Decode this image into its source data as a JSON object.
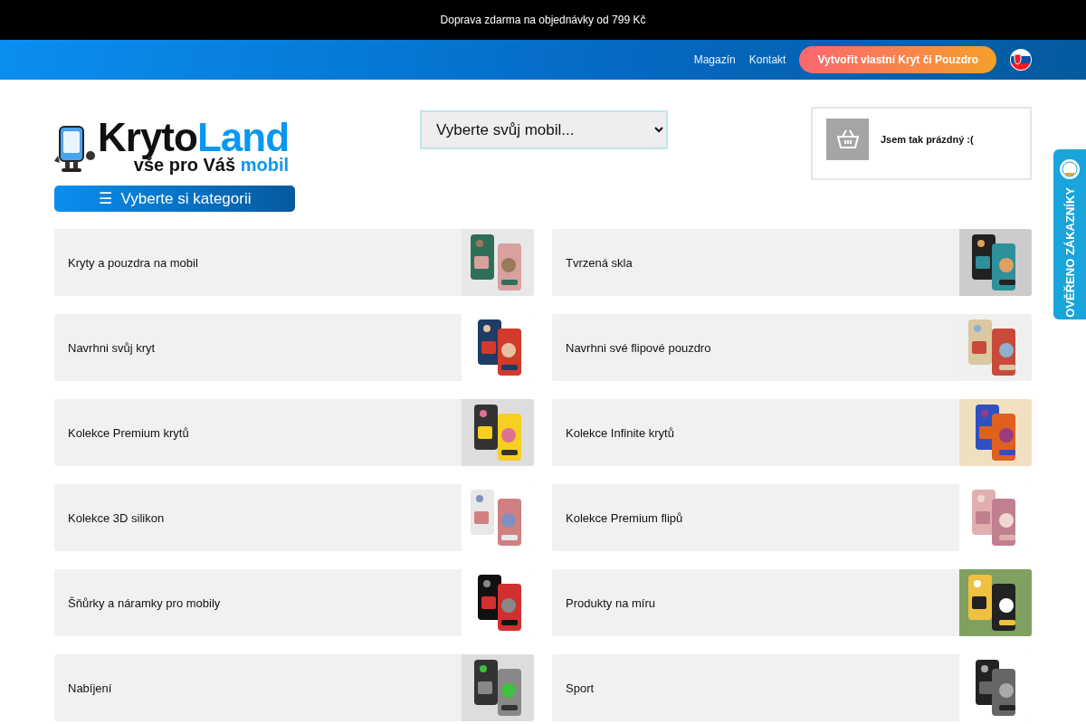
{
  "promo_bar": {
    "text": "Doprava zdarma na objednávky od 799 Kč"
  },
  "nav": {
    "links": [
      "Magazín",
      "Kontakt"
    ],
    "cta": "Vytvořit vlastní Kryt či Pouzdro"
  },
  "logo": {
    "word_1": "Kryto",
    "word_2": "Land",
    "tagline_1": "vše pro Váš",
    "tagline_2": "mobil"
  },
  "category_menu": {
    "icon": "☰",
    "label": "Vyberte si kategorii"
  },
  "phone_select": {
    "value": "Vyberte svůj mobil..."
  },
  "cart": {
    "text": "Jsem tak prázdný :("
  },
  "categories": [
    {
      "label": "Kryty a pouzdra na mobil",
      "kind": "picture"
    },
    {
      "label": "Tvrzená skla",
      "kind": "picture"
    },
    {
      "label": "Navrhni svůj kryt",
      "kind": "picture"
    },
    {
      "label": "Navrhni své flipové pouzdro",
      "kind": "picture"
    },
    {
      "label": "Kolekce Premium krytů",
      "kind": "picture"
    },
    {
      "label": "Kolekce Infinite krytů",
      "kind": "picture"
    },
    {
      "label": "Kolekce 3D silikon",
      "kind": "picture"
    },
    {
      "label": "Kolekce Premium flipů",
      "kind": "picture"
    },
    {
      "label": "Šňůrky a náramky pro mobily",
      "kind": "picture"
    },
    {
      "label": "Produkty na míru",
      "kind": "picture"
    },
    {
      "label": "Nabíjení",
      "kind": "picture"
    },
    {
      "label": "Sport",
      "kind": "picture"
    }
  ],
  "verified_badge": {
    "text": "OVĚŘENO ZÁKAZNÍKY"
  }
}
